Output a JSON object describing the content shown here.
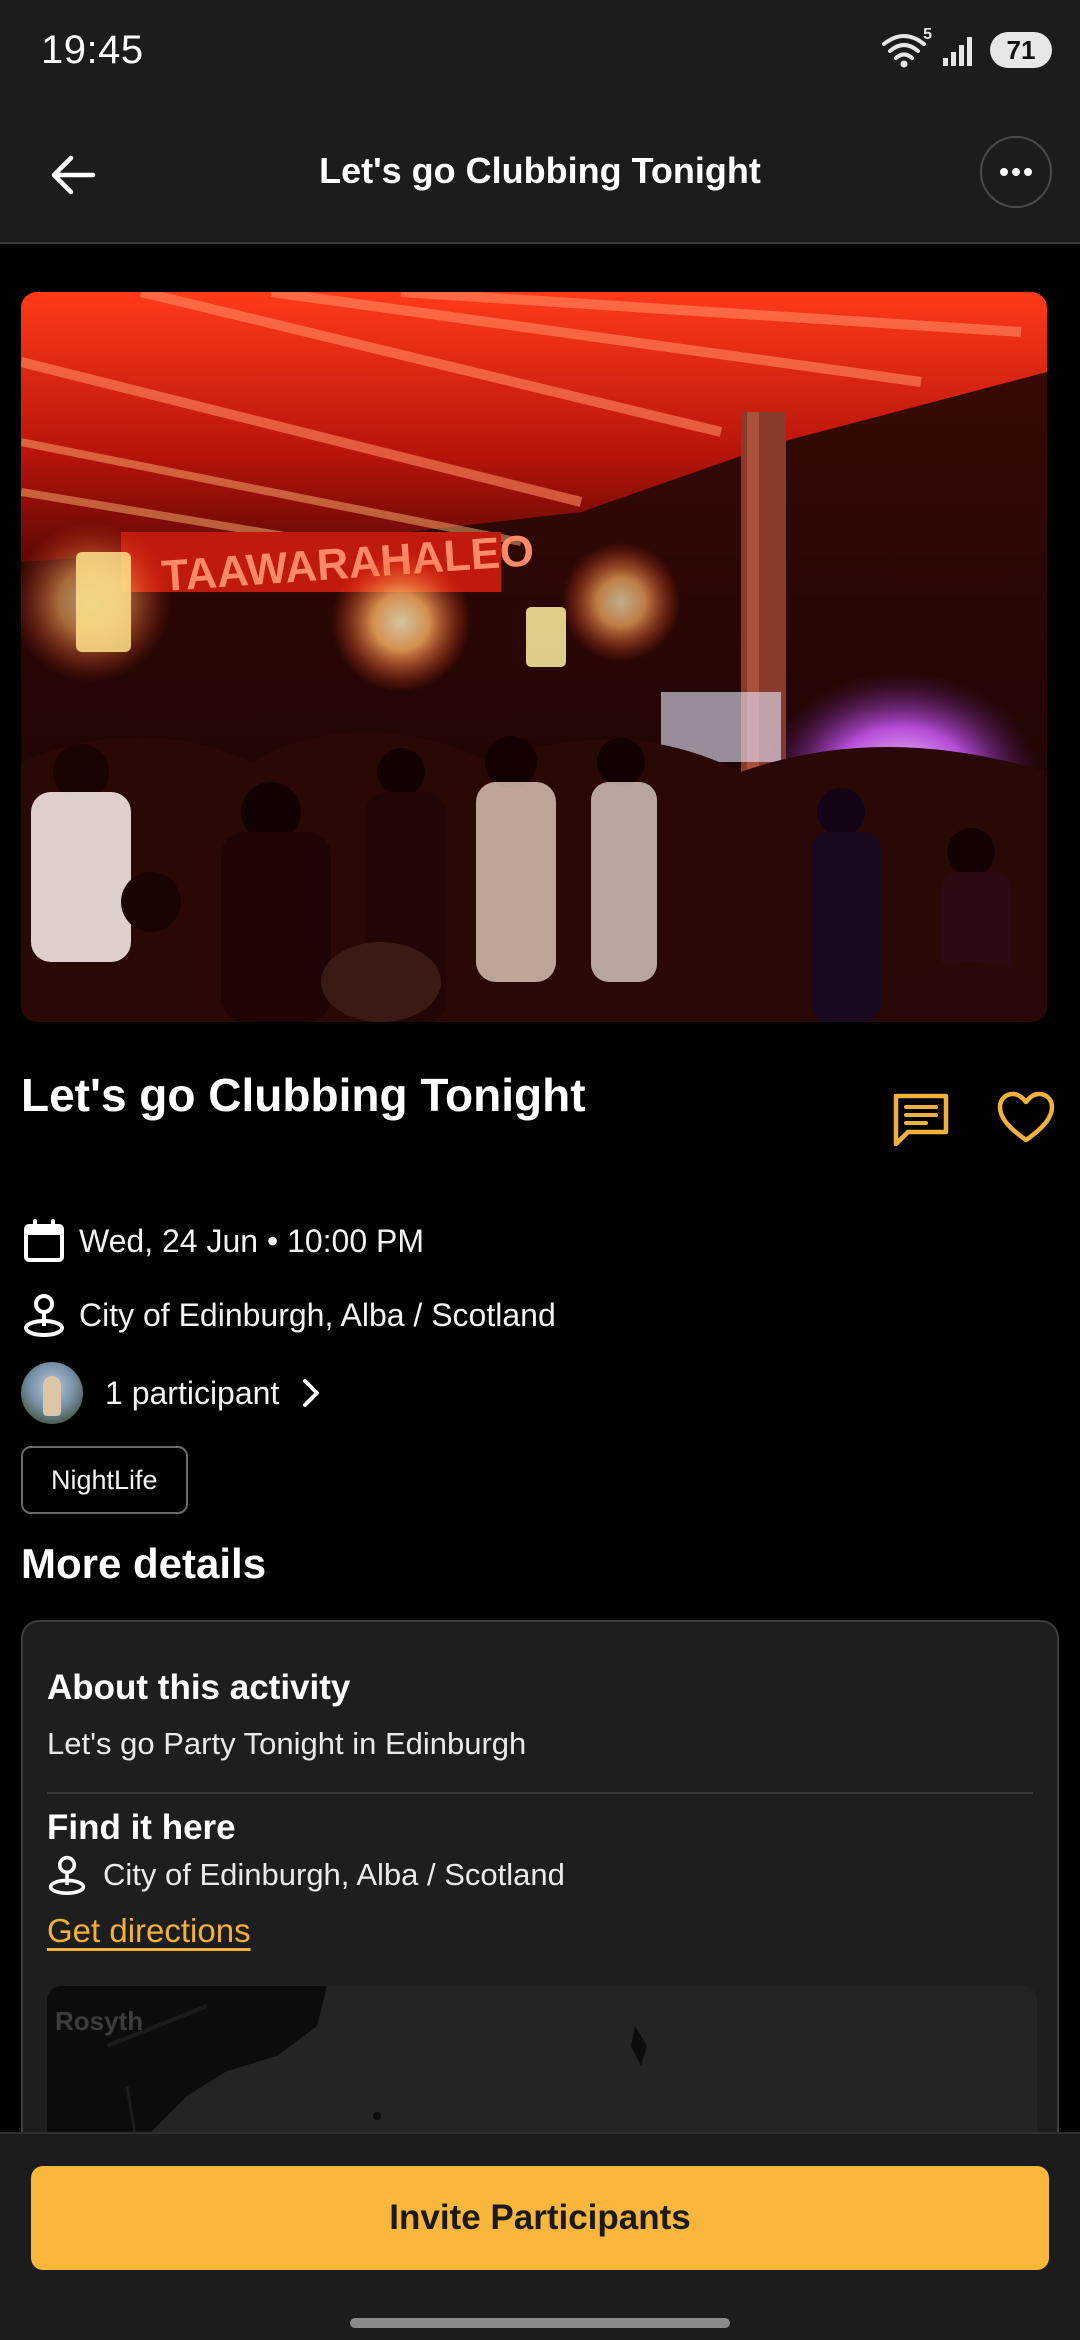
{
  "status_bar": {
    "time": "19:45",
    "network_badge": "5",
    "battery": "71",
    "icons": [
      "wifi-icon",
      "signal-icon",
      "battery-icon"
    ]
  },
  "app_bar": {
    "title": "Let's go Clubbing Tonight",
    "back_icon": "arrow-left-icon",
    "more_icon": "more-horizontal-icon"
  },
  "hero": {
    "sign_text": "TAAWARAHALEO"
  },
  "event": {
    "title": "Let's go Clubbing Tonight",
    "date": "Wed, 24 Jun • 10:00 PM",
    "location": "City of Edinburgh, Alba / Scotland",
    "participants": "1 participant",
    "tag": "NightLife"
  },
  "more_details": {
    "heading": "More details",
    "about_heading": "About this activity",
    "about_text": "Let's go Party Tonight in Edinburgh",
    "find_heading": "Find it here",
    "find_location": "City of Edinburgh, Alba / Scotland",
    "directions_label": "Get directions",
    "map_label": "Rosyth"
  },
  "cta": {
    "invite_label": "Invite Participants"
  },
  "colors": {
    "accent": "#fbb73c",
    "background": "#000000",
    "surface": "#1c1c1c",
    "card": "#1e1e1e"
  }
}
